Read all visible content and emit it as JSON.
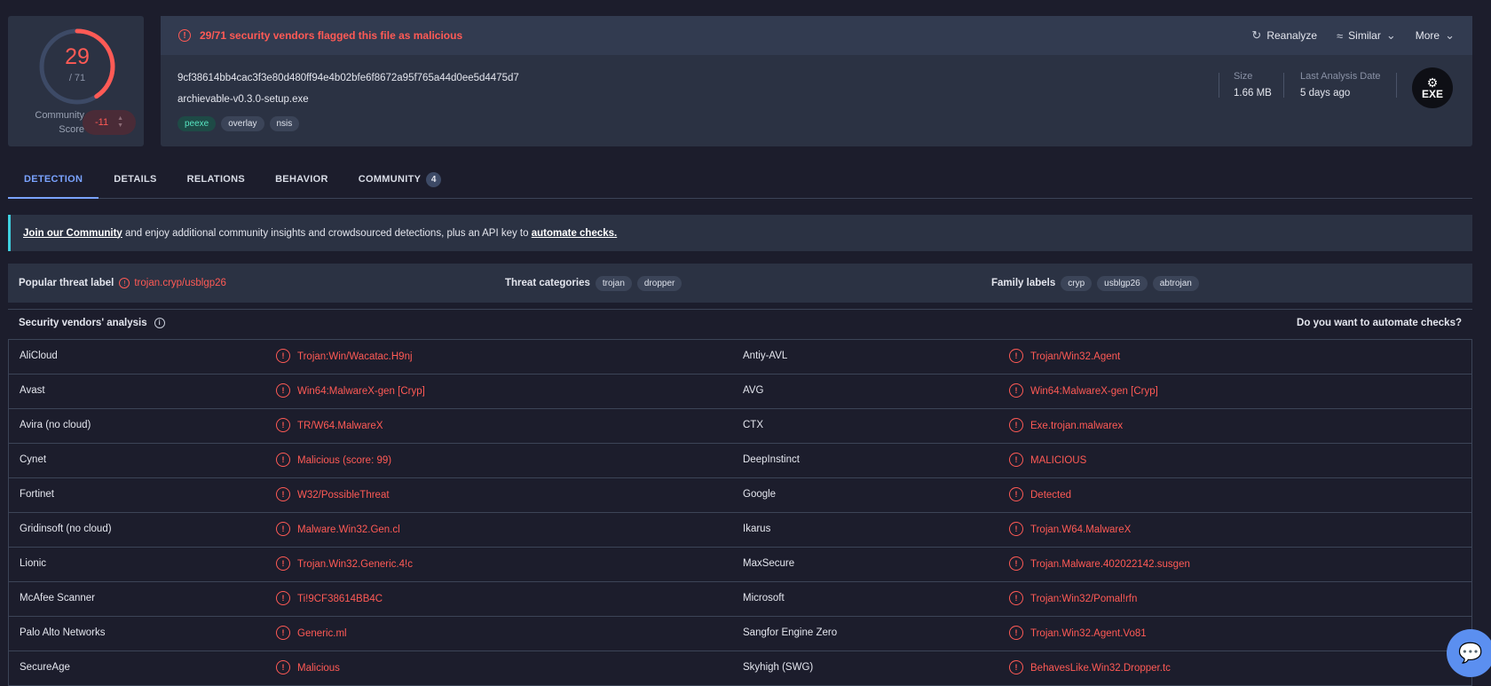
{
  "score": {
    "detections": "29",
    "total": "/ 71",
    "detected_fraction": 0.408,
    "community_label": "Community Score",
    "community_value": "-11"
  },
  "header": {
    "alert": "29/71 security vendors flagged this file as malicious",
    "actions": [
      {
        "label": "Reanalyze",
        "icon": "refresh-icon"
      },
      {
        "label": "Similar",
        "icon": "similar-icon"
      },
      {
        "label": "More",
        "icon": "chevron-down-icon"
      }
    ],
    "hash": "9cf38614bb4cac3f3e80d480ff94e4b02bfe6f8672a95f765a44d0ee5d4475d7",
    "filename": "archievable-v0.3.0-setup.exe",
    "tags": [
      "peexe",
      "overlay",
      "nsis"
    ],
    "size_label": "Size",
    "size_value": "1.66 MB",
    "date_label": "Last Analysis Date",
    "date_value": "5 days ago",
    "file_type": "EXE"
  },
  "tabs": [
    {
      "label": "DETECTION"
    },
    {
      "label": "DETAILS"
    },
    {
      "label": "RELATIONS"
    },
    {
      "label": "BEHAVIOR"
    },
    {
      "label": "COMMUNITY",
      "badge": "4"
    }
  ],
  "banner": {
    "link1": "Join our Community",
    "text": " and enjoy additional community insights and crowdsourced detections, plus an API key to ",
    "link2": "automate checks."
  },
  "threat": {
    "popular_key": "Popular threat label",
    "popular_value": "trojan.cryp/usblgp26",
    "categories_key": "Threat categories",
    "categories": [
      "trojan",
      "dropper"
    ],
    "family_key": "Family labels",
    "families": [
      "cryp",
      "usblgp26",
      "abtrojan"
    ]
  },
  "vendors": {
    "title": "Security vendors' analysis",
    "automate": "Do you want to automate checks?",
    "rows": [
      {
        "v1": "AliCloud",
        "r1": "Trojan:Win/Wacatac.H9nj",
        "v2": "Antiy-AVL",
        "r2": "Trojan/Win32.Agent"
      },
      {
        "v1": "Avast",
        "r1": "Win64:MalwareX-gen [Cryp]",
        "v2": "AVG",
        "r2": "Win64:MalwareX-gen [Cryp]"
      },
      {
        "v1": "Avira (no cloud)",
        "r1": "TR/W64.MalwareX",
        "v2": "CTX",
        "r2": "Exe.trojan.malwarex"
      },
      {
        "v1": "Cynet",
        "r1": "Malicious (score: 99)",
        "v2": "DeepInstinct",
        "r2": "MALICIOUS"
      },
      {
        "v1": "Fortinet",
        "r1": "W32/PossibleThreat",
        "v2": "Google",
        "r2": "Detected"
      },
      {
        "v1": "Gridinsoft (no cloud)",
        "r1": "Malware.Win32.Gen.cl",
        "v2": "Ikarus",
        "r2": "Trojan.W64.MalwareX"
      },
      {
        "v1": "Lionic",
        "r1": "Trojan.Win32.Generic.4!c",
        "v2": "MaxSecure",
        "r2": "Trojan.Malware.402022142.susgen"
      },
      {
        "v1": "McAfee Scanner",
        "r1": "Ti!9CF38614BB4C",
        "v2": "Microsoft",
        "r2": "Trojan:Win32/Pomal!rfn"
      },
      {
        "v1": "Palo Alto Networks",
        "r1": "Generic.ml",
        "v2": "Sangfor Engine Zero",
        "r2": "Trojan.Win32.Agent.Vo81"
      },
      {
        "v1": "SecureAge",
        "r1": "Malicious",
        "v2": "Skyhigh (SWG)",
        "r2": "BehavesLike.Win32.Dropper.tc"
      }
    ]
  },
  "colors": {
    "malicious": "#ff5a55",
    "accent": "#7aa3ff",
    "background": "#1c1d2c",
    "card": "#2b3243"
  }
}
